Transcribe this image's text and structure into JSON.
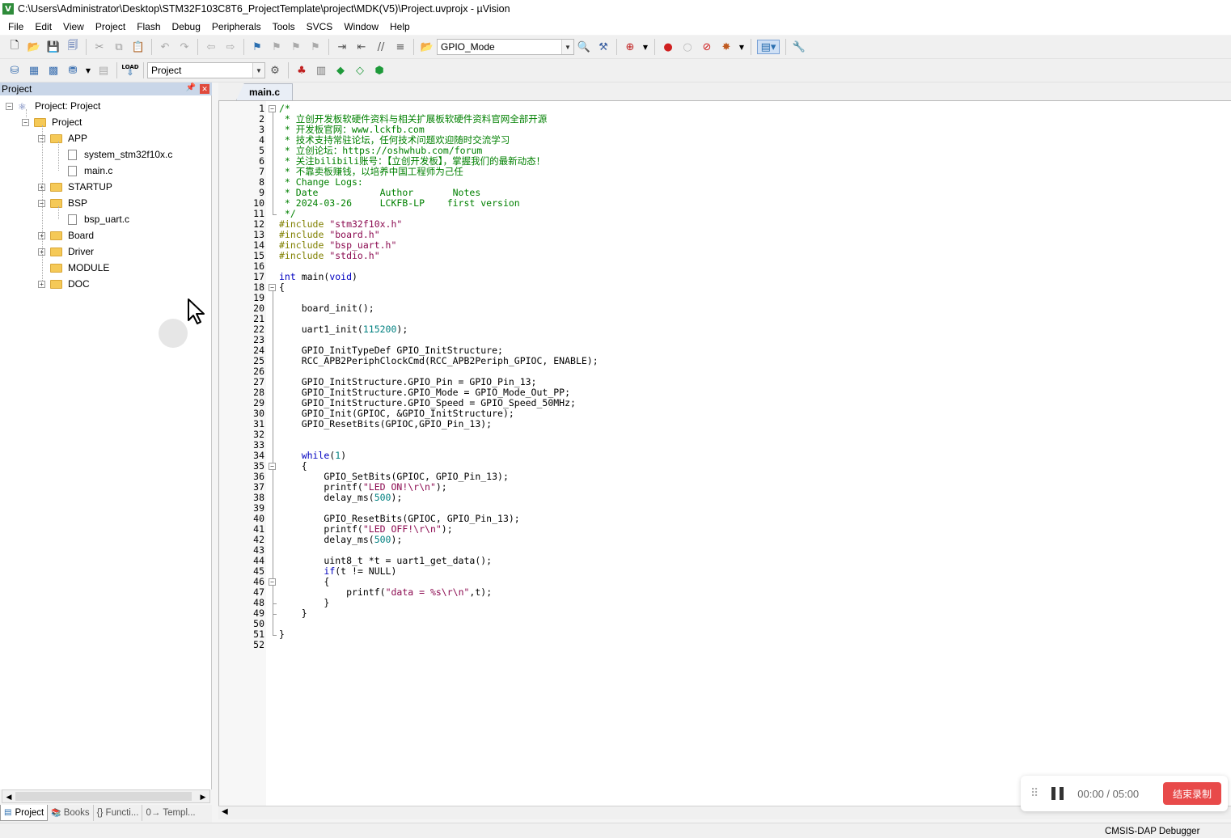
{
  "window": {
    "title": "C:\\Users\\Administrator\\Desktop\\STM32F103C8T6_ProjectTemplate\\project\\MDK(V5)\\Project.uvprojx - µVision",
    "app_icon": "V"
  },
  "menu": [
    "File",
    "Edit",
    "View",
    "Project",
    "Flash",
    "Debug",
    "Peripherals",
    "Tools",
    "SVCS",
    "Window",
    "Help"
  ],
  "toolbar": {
    "find_combo_value": "GPIO_Mode",
    "target_combo_value": "Project",
    "load_label": "LOAD"
  },
  "project_panel": {
    "header": "Project",
    "tree": [
      {
        "label": "Project: Project",
        "type": "root",
        "expander": "−"
      },
      {
        "label": "Project",
        "type": "target",
        "expander": "−"
      },
      {
        "label": "APP",
        "type": "folder",
        "expander": "−"
      },
      {
        "label": "system_stm32f10x.c",
        "type": "file"
      },
      {
        "label": "main.c",
        "type": "file"
      },
      {
        "label": "STARTUP",
        "type": "folder",
        "expander": "+"
      },
      {
        "label": "BSP",
        "type": "folder",
        "expander": "−"
      },
      {
        "label": "bsp_uart.c",
        "type": "file"
      },
      {
        "label": "Board",
        "type": "folder",
        "expander": "+"
      },
      {
        "label": "Driver",
        "type": "folder",
        "expander": "+"
      },
      {
        "label": "MODULE",
        "type": "folder"
      },
      {
        "label": "DOC",
        "type": "folder",
        "expander": "+"
      }
    ],
    "bottom_tabs": [
      "Project",
      "Books",
      "{} Functi...",
      "0→ Templ..."
    ]
  },
  "editor": {
    "tab": "main.c",
    "lines": [
      [
        {
          "t": "/*",
          "c": "comment"
        }
      ],
      [
        {
          "t": " * 立创开发板软硬件资料与相关扩展板软硬件资料官网全部开源",
          "c": "comment"
        }
      ],
      [
        {
          "t": " * 开发板官网：www.lckfb.com",
          "c": "comment"
        }
      ],
      [
        {
          "t": " * 技术支持常驻论坛，任何技术问题欢迎随时交流学习",
          "c": "comment"
        }
      ],
      [
        {
          "t": " * 立创论坛：https://oshwhub.com/forum",
          "c": "comment"
        }
      ],
      [
        {
          "t": " * 关注bilibili账号：【立创开发板】，掌握我们的最新动态！",
          "c": "comment"
        }
      ],
      [
        {
          "t": " * 不靠卖板赚钱，以培养中国工程师为己任",
          "c": "comment"
        }
      ],
      [
        {
          "t": " * Change Logs:",
          "c": "comment"
        }
      ],
      [
        {
          "t": " * Date           Author       Notes",
          "c": "comment"
        }
      ],
      [
        {
          "t": " * 2024-03-26     LCKFB-LP    first version",
          "c": "comment"
        }
      ],
      [
        {
          "t": " */",
          "c": "comment"
        }
      ],
      [
        {
          "t": "#include ",
          "c": "pre"
        },
        {
          "t": "\"stm32f10x.h\"",
          "c": "string"
        }
      ],
      [
        {
          "t": "#include ",
          "c": "pre"
        },
        {
          "t": "\"board.h\"",
          "c": "string"
        }
      ],
      [
        {
          "t": "#include ",
          "c": "pre"
        },
        {
          "t": "\"bsp_uart.h\"",
          "c": "string"
        }
      ],
      [
        {
          "t": "#include ",
          "c": "pre"
        },
        {
          "t": "\"stdio.h\"",
          "c": "string"
        }
      ],
      [],
      [
        {
          "t": "int",
          "c": "kw"
        },
        {
          "t": " main(",
          "c": "plain"
        },
        {
          "t": "void",
          "c": "kw"
        },
        {
          "t": ")",
          "c": "plain"
        }
      ],
      [
        {
          "t": "{",
          "c": "plain"
        }
      ],
      [],
      [
        {
          "t": "    board_init();",
          "c": "plain"
        }
      ],
      [],
      [
        {
          "t": "    uart1_init(",
          "c": "plain"
        },
        {
          "t": "115200",
          "c": "num"
        },
        {
          "t": ");",
          "c": "plain"
        }
      ],
      [],
      [
        {
          "t": "    GPIO_InitTypeDef GPIO_InitStructure;",
          "c": "plain"
        }
      ],
      [
        {
          "t": "    RCC_APB2PeriphClockCmd(RCC_APB2Periph_GPIOC, ENABLE);",
          "c": "plain"
        }
      ],
      [],
      [
        {
          "t": "    GPIO_InitStructure.GPIO_Pin = GPIO_Pin_13;",
          "c": "plain"
        }
      ],
      [
        {
          "t": "    GPIO_InitStructure.GPIO_Mode = GPIO_Mode_Out_PP;",
          "c": "plain"
        }
      ],
      [
        {
          "t": "    GPIO_InitStructure.GPIO_Speed = GPIO_Speed_50MHz;",
          "c": "plain"
        }
      ],
      [
        {
          "t": "    GPIO_Init(GPIOC, &GPIO_InitStructure);",
          "c": "plain"
        }
      ],
      [
        {
          "t": "    GPIO_ResetBits(GPIOC,GPIO_Pin_13);",
          "c": "plain"
        }
      ],
      [],
      [],
      [
        {
          "t": "    ",
          "c": "plain"
        },
        {
          "t": "while",
          "c": "kw"
        },
        {
          "t": "(",
          "c": "plain"
        },
        {
          "t": "1",
          "c": "num"
        },
        {
          "t": ")",
          "c": "plain"
        }
      ],
      [
        {
          "t": "    {",
          "c": "plain"
        }
      ],
      [
        {
          "t": "        GPIO_SetBits(GPIOC, GPIO_Pin_13);",
          "c": "plain"
        }
      ],
      [
        {
          "t": "        printf(",
          "c": "plain"
        },
        {
          "t": "\"LED ON!\\r\\n\"",
          "c": "string"
        },
        {
          "t": ");",
          "c": "plain"
        }
      ],
      [
        {
          "t": "        delay_ms(",
          "c": "plain"
        },
        {
          "t": "500",
          "c": "num"
        },
        {
          "t": ");",
          "c": "plain"
        }
      ],
      [],
      [
        {
          "t": "        GPIO_ResetBits(GPIOC, GPIO_Pin_13);",
          "c": "plain"
        }
      ],
      [
        {
          "t": "        printf(",
          "c": "plain"
        },
        {
          "t": "\"LED OFF!\\r\\n\"",
          "c": "string"
        },
        {
          "t": ");",
          "c": "plain"
        }
      ],
      [
        {
          "t": "        delay_ms(",
          "c": "plain"
        },
        {
          "t": "500",
          "c": "num"
        },
        {
          "t": ");",
          "c": "plain"
        }
      ],
      [],
      [
        {
          "t": "        uint8_t *t = uart1_get_data();",
          "c": "plain"
        }
      ],
      [
        {
          "t": "        ",
          "c": "plain"
        },
        {
          "t": "if",
          "c": "kw"
        },
        {
          "t": "(t != NULL)",
          "c": "plain"
        }
      ],
      [
        {
          "t": "        {",
          "c": "plain"
        }
      ],
      [
        {
          "t": "            printf(",
          "c": "plain"
        },
        {
          "t": "\"data = %s\\r\\n\"",
          "c": "string"
        },
        {
          "t": ",t);",
          "c": "plain"
        }
      ],
      [
        {
          "t": "        }",
          "c": "plain"
        }
      ],
      [
        {
          "t": "    }",
          "c": "plain"
        }
      ],
      [],
      [
        {
          "t": "}",
          "c": "plain"
        }
      ],
      []
    ]
  },
  "recorder": {
    "time": "00:00 / 05:00",
    "stop_label": "结束录制"
  },
  "status": {
    "debugger": "CMSIS-DAP Debugger"
  }
}
